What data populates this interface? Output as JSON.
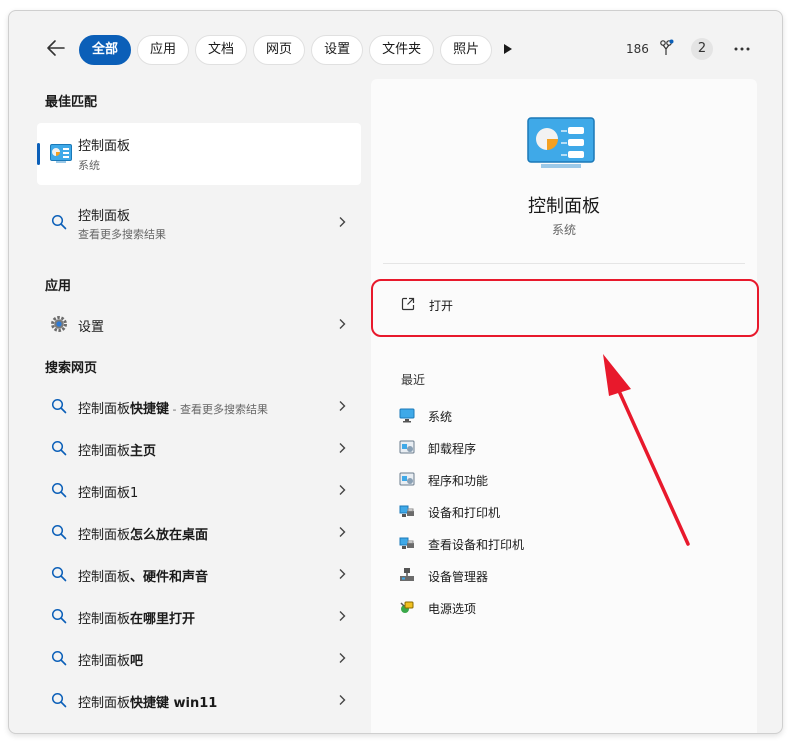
{
  "topbar": {
    "tabs": [
      "全部",
      "应用",
      "文档",
      "网页",
      "设置",
      "文件夹",
      "照片"
    ],
    "points": "186",
    "avatar_initial": "2"
  },
  "best_match": {
    "title": "最佳匹配",
    "name": "控制面板",
    "type": "系统"
  },
  "web_more": {
    "name": "控制面板",
    "sub": "查看更多搜索结果"
  },
  "apps": {
    "title": "应用",
    "settings_label": "设置"
  },
  "web": {
    "title": "搜索网页",
    "items": [
      {
        "prefix": "控制面板",
        "bold": "快捷键",
        "suffix": " - 查看更多搜索结果"
      },
      {
        "prefix": "控制面板",
        "bold": "主页",
        "suffix": ""
      },
      {
        "prefix": "控制面板1",
        "bold": "",
        "suffix": ""
      },
      {
        "prefix": "控制面板",
        "bold": "怎么放在桌面",
        "suffix": ""
      },
      {
        "prefix": "控制面板",
        "bold": "、硬件和声音",
        "suffix": ""
      },
      {
        "prefix": "控制面板",
        "bold": "在哪里打开",
        "suffix": ""
      },
      {
        "prefix": "控制面板",
        "bold": "吧",
        "suffix": ""
      },
      {
        "prefix": "控制面板",
        "bold": "快捷键 win11",
        "suffix": ""
      }
    ]
  },
  "detail": {
    "name": "控制面板",
    "type": "系统",
    "open_label": "打开",
    "recent_title": "最近",
    "recent": [
      {
        "label": "系统",
        "icon": "monitor-icon"
      },
      {
        "label": "卸载程序",
        "icon": "programs-icon"
      },
      {
        "label": "程序和功能",
        "icon": "programs-icon"
      },
      {
        "label": "设备和打印机",
        "icon": "printer-icon"
      },
      {
        "label": "查看设备和打印机",
        "icon": "printer-icon"
      },
      {
        "label": "设备管理器",
        "icon": "device-manager-icon"
      },
      {
        "label": "电源选项",
        "icon": "power-options-icon"
      }
    ]
  },
  "colors": {
    "accent": "#0b5fb8",
    "highlight": "#e8192c"
  }
}
